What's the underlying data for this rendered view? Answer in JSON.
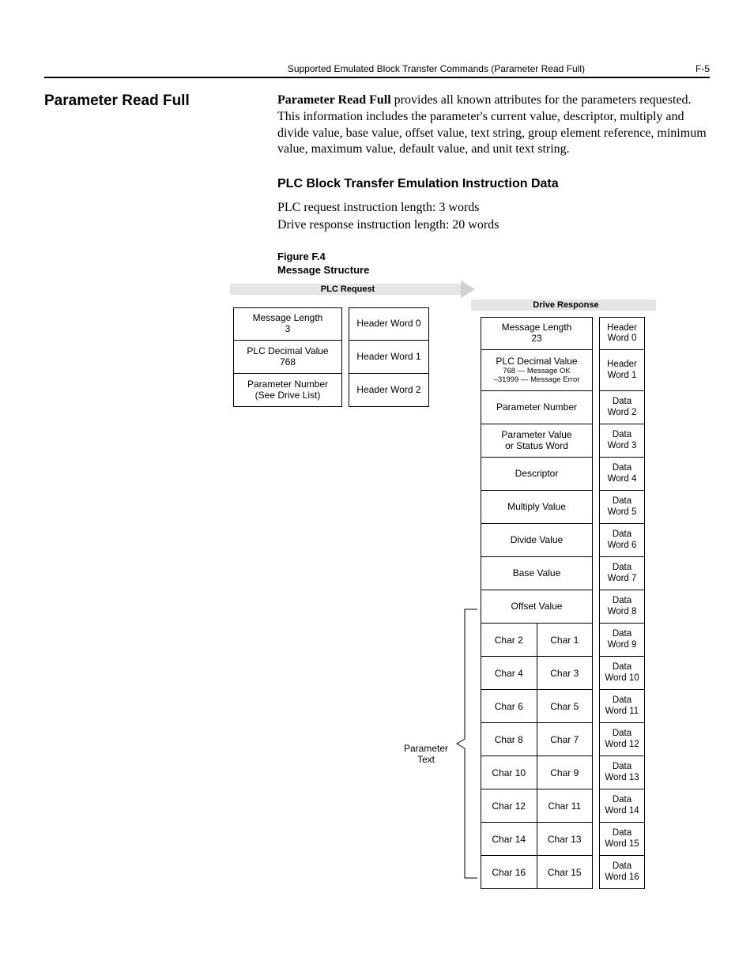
{
  "header": {
    "breadcrumb": "Supported Emulated Block Transfer Commands (Parameter Read Full)",
    "page_num": "F-5"
  },
  "section_title": "Parameter Read Full",
  "intro_bold": "Parameter Read Full",
  "intro_rest": " provides all known attributes for the parameters requested. This information includes the parameter's current value, descriptor, multiply and divide value, base value, offset value, text string, group element reference, minimum value, maximum value, default value, and unit text string.",
  "subhead": "PLC Block Transfer Emulation Instruction Data",
  "body_line1": "PLC request instruction length: 3 words",
  "body_line2": "Drive response instruction length: 20 words",
  "fig_num": "Figure F.4",
  "fig_title": "Message Structure",
  "plc_title": "PLC Request",
  "drive_title": "Drive Response",
  "param_text_label": "Parameter\nText",
  "plc_left": [
    {
      "l1": "Message Length",
      "l2": "3"
    },
    {
      "l1": "PLC Decimal Value",
      "l2": "768"
    },
    {
      "l1": "Parameter Number",
      "l2": "(See Drive List)"
    }
  ],
  "plc_right": [
    "Header Word 0",
    "Header Word 1",
    "Header Word 2"
  ],
  "resp_left": [
    {
      "type": "two",
      "l1": "Message Length",
      "l2": "23"
    },
    {
      "type": "three",
      "l1": "PLC Decimal Value",
      "l2": "768 — Message OK",
      "l3": "–31999 — Message Error"
    },
    {
      "type": "one",
      "l1": "Parameter Number"
    },
    {
      "type": "two",
      "l1": "Parameter Value",
      "l2": "or Status Word"
    },
    {
      "type": "one",
      "l1": "Descriptor"
    },
    {
      "type": "one",
      "l1": "Multiply Value"
    },
    {
      "type": "one",
      "l1": "Divide Value"
    },
    {
      "type": "one",
      "l1": "Base Value"
    },
    {
      "type": "one",
      "l1": "Offset Value"
    }
  ],
  "resp_chars": [
    [
      "Char 2",
      "Char 1"
    ],
    [
      "Char 4",
      "Char 3"
    ],
    [
      "Char 6",
      "Char 5"
    ],
    [
      "Char 8",
      "Char 7"
    ],
    [
      "Char 10",
      "Char 9"
    ],
    [
      "Char 12",
      "Char 11"
    ],
    [
      "Char 14",
      "Char 13"
    ],
    [
      "Char 16",
      "Char 15"
    ]
  ],
  "resp_right": [
    {
      "l1": "Header",
      "l2": "Word 0"
    },
    {
      "l1": "Header",
      "l2": "Word 1",
      "tall": true
    },
    {
      "l1": "Data",
      "l2": "Word 2"
    },
    {
      "l1": "Data",
      "l2": "Word 3"
    },
    {
      "l1": "Data",
      "l2": "Word 4"
    },
    {
      "l1": "Data",
      "l2": "Word 5"
    },
    {
      "l1": "Data",
      "l2": "Word 6"
    },
    {
      "l1": "Data",
      "l2": "Word 7"
    },
    {
      "l1": "Data",
      "l2": "Word 8"
    },
    {
      "l1": "Data",
      "l2": "Word 9"
    },
    {
      "l1": "Data",
      "l2": "Word 10"
    },
    {
      "l1": "Data",
      "l2": "Word 11"
    },
    {
      "l1": "Data",
      "l2": "Word 12"
    },
    {
      "l1": "Data",
      "l2": "Word 13"
    },
    {
      "l1": "Data",
      "l2": "Word 14"
    },
    {
      "l1": "Data",
      "l2": "Word 15"
    },
    {
      "l1": "Data",
      "l2": "Word 16"
    }
  ]
}
